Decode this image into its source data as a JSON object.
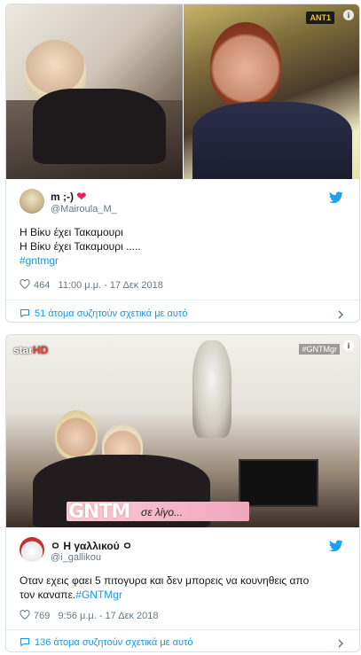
{
  "tweets": [
    {
      "channel_logo": "ΑΝΤ1",
      "display_name": "m ;-)",
      "handle": "@Mairoula_M_",
      "text_line1": "Η Βίκυ έχει Τακαμουρι",
      "text_line2": "Η Βίκυ έχει Τακαμουρι .....",
      "hashtag": "#gntmgr",
      "likes": "464",
      "timestamp": "11:00 μ.μ. - 17 Δεκ 2018",
      "conversation": "51 άτομα συζητούν σχετικά με αυτό"
    },
    {
      "channel_logo": "star",
      "channel_logo_suffix": "HD",
      "channel_tag": "#GNTMgr",
      "banner_title": "GNTM",
      "banner_text": "σε λίγο...",
      "display_name": "ㅇ Η γαλλικού ㅇ",
      "handle": "@i_gallikou",
      "text_line1": "Οταν εχεις φαει 5 πιτογυρα και δεν μπορεις να κουνηθεις απο",
      "text_line2_prefix": "τον καναπε.",
      "hashtag": "#GNTMgr",
      "likes": "769",
      "timestamp": "9:56 μ.μ. - 17 Δεκ 2018",
      "conversation": "136 άτομα συζητούν σχετικά με αυτό"
    }
  ],
  "colors": {
    "link": "#1b95e0",
    "heart_emoji": "#e0245e",
    "twitter_blue": "#1da1f2"
  },
  "icons": [
    "twitter-bird-icon",
    "heart-icon",
    "speech-bubble-icon",
    "chevron-right-icon",
    "info-icon"
  ]
}
